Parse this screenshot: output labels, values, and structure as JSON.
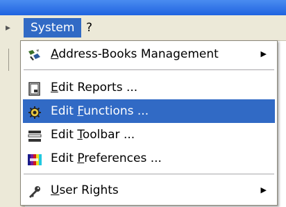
{
  "menubar": {
    "items": [
      {
        "label": "System",
        "active": true
      },
      {
        "label": "?",
        "active": false
      }
    ]
  },
  "menu": {
    "items": [
      {
        "pre": "",
        "acc": "A",
        "post": "ddress-Books Management",
        "icon": "address-books-icon",
        "submenu": true
      },
      {
        "pre": "",
        "acc": "E",
        "post": "dit Reports ...",
        "icon": "report-icon",
        "submenu": false
      },
      {
        "pre": "Edit ",
        "acc": "F",
        "post": "unctions ...",
        "icon": "functions-gear-icon",
        "submenu": false,
        "highlighted": true
      },
      {
        "pre": "Edit ",
        "acc": "T",
        "post": "oolbar ...",
        "icon": "toolbar-icon",
        "submenu": false
      },
      {
        "pre": "Edit ",
        "acc": "P",
        "post": "references ...",
        "icon": "preferences-color-icon",
        "submenu": false
      },
      {
        "pre": "",
        "acc": "U",
        "post": "ser Rights",
        "icon": "key-icon",
        "submenu": true
      }
    ],
    "highlight_color": "#316ac5"
  }
}
